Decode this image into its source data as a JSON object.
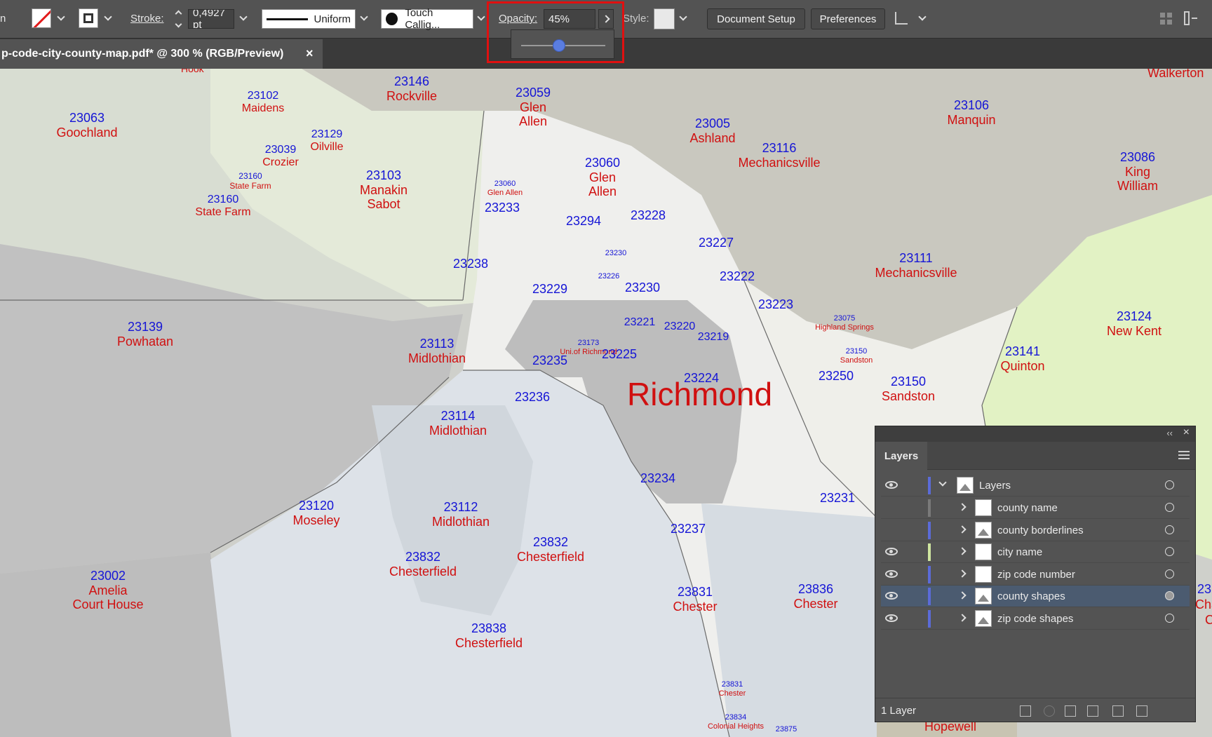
{
  "control_bar": {
    "left_cut_label": "n",
    "stroke_label": "Stroke:",
    "stroke_value": "0,4927 pt",
    "profile_label": "Uniform",
    "brush_label": "Touch Callig...",
    "opacity_label": "Opacity:",
    "opacity_value": "45%",
    "opacity_slider_value": 0.45,
    "style_label": "Style:",
    "document_setup_label": "Document Setup",
    "preferences_label": "Preferences"
  },
  "document_tab": {
    "title": "p-code-city-county-map.pdf* @ 300 % (RGB/Preview)",
    "close_glyph": "×"
  },
  "map": {
    "big_city": "Richmond",
    "labels": [
      {
        "zip": "23146",
        "city": "Rockville"
      },
      {
        "zip": "23102",
        "city": "Maidens"
      },
      {
        "zip": "23063",
        "city": "Goochland"
      },
      {
        "zip": "23129",
        "city": "Oilville"
      },
      {
        "zip": "23039",
        "city": "Crozier"
      },
      {
        "zip": "23160",
        "city": "State Farm"
      },
      {
        "zip": "23160",
        "city": "State Farm"
      },
      {
        "zip": "23103",
        "city": "Manakin Sabot"
      },
      {
        "zip": "23059",
        "city": "Glen Allen"
      },
      {
        "zip": "23060",
        "city": "Glen Allen"
      },
      {
        "zip": "23060",
        "city": "Glen Allen"
      },
      {
        "zip": "23005",
        "city": "Ashland"
      },
      {
        "zip": "23116",
        "city": "Mechanicsville"
      },
      {
        "zip": "23106",
        "city": "Manquin"
      },
      {
        "zip": "23086",
        "city": "King William"
      },
      {
        "zip": "23111",
        "city": "Mechanicsville"
      },
      {
        "zip": "23124",
        "city": "New Kent"
      },
      {
        "zip": "23141",
        "city": "Quinton"
      },
      {
        "zip": "23139",
        "city": "Powhatan"
      },
      {
        "zip": "23113",
        "city": "Midlothian"
      },
      {
        "zip": "23114",
        "city": "Midlothian"
      },
      {
        "zip": "23112",
        "city": "Midlothian"
      },
      {
        "zip": "23120",
        "city": "Moseley"
      },
      {
        "zip": "23832",
        "city": "Chesterfield"
      },
      {
        "zip": "23832",
        "city": "Chesterfield"
      },
      {
        "zip": "23002",
        "city": "Amelia Court House"
      },
      {
        "zip": "23838",
        "city": "Chesterfield"
      },
      {
        "zip": "23831",
        "city": "Chester"
      },
      {
        "zip": "23836",
        "city": "Chester"
      },
      {
        "zip": "23831",
        "city": "Chester"
      },
      {
        "zip": "23834",
        "city": "Colonial Heights"
      },
      {
        "zip": "23075",
        "city": "Highland Springs"
      },
      {
        "zip": "23150",
        "city": "Sandston"
      },
      {
        "zip": "23150",
        "city": "Sandston"
      },
      {
        "zip": "23173",
        "city": "Uni.of Richmond"
      }
    ],
    "zip_only": [
      "23233",
      "23294",
      "23228",
      "23227",
      "23238",
      "23230",
      "23226",
      "23229",
      "23230",
      "23222",
      "23223",
      "23221",
      "23220",
      "23219",
      "23235",
      "23225",
      "23224",
      "23236",
      "23250",
      "23234",
      "23231",
      "23237",
      "23875"
    ],
    "edge_labels": {
      "hook": "Hook",
      "walkerton": "Walkerton",
      "hopewell": "Hopewell",
      "right_zip": "23",
      "right_city": "Cha",
      "right_city2": "C"
    }
  },
  "layers_panel": {
    "title": "Layers",
    "footer_text": "1 Layer",
    "parent_layer": "Layers",
    "sublayers": [
      {
        "name": "county name",
        "visible": false,
        "color": "#7a7a7a"
      },
      {
        "name": "county borderlines",
        "visible": false,
        "color": "#5b6bd8"
      },
      {
        "name": "city name",
        "visible": true,
        "color": "#cfe6a0"
      },
      {
        "name": "zip code number",
        "visible": true,
        "color": "#5b6bd8"
      },
      {
        "name": "county shapes",
        "visible": true,
        "color": "#5b6bd8",
        "selected": true
      },
      {
        "name": "zip code shapes",
        "visible": true,
        "color": "#5b6bd8"
      }
    ]
  },
  "colors": {
    "zip_text": "#1515d6",
    "city_text": "#d01010",
    "highlight": "#e01010",
    "selection": "#4b5b70"
  }
}
